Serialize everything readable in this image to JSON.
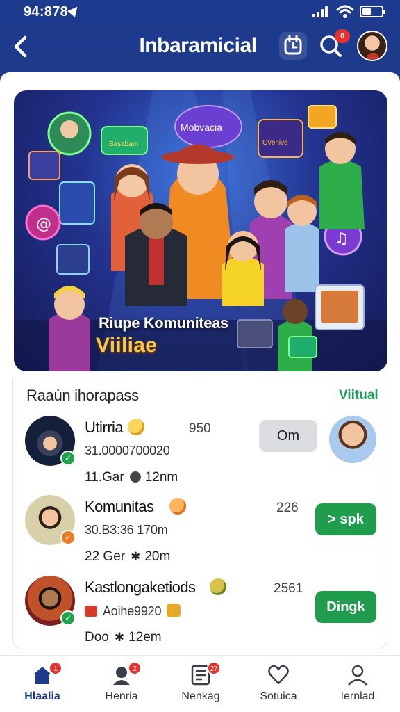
{
  "status": {
    "time": "94:878"
  },
  "header": {
    "title": "Inbaramicial",
    "notification_badge": "8"
  },
  "hero": {
    "title": "Riupe Komuniteas",
    "subtitle": "Viiliae",
    "bubble_text": "Mobvacia",
    "sign_left": "Basabam",
    "sign_right": "Ovenive"
  },
  "section": {
    "title": "Raaùn ihorapass",
    "link": "Viitual"
  },
  "rows": [
    {
      "name": "Utirria",
      "count": "950",
      "sub": "31.0000700020",
      "meta_left": "11.Gar",
      "meta_right": "12nm",
      "action": "Om"
    },
    {
      "name": "Komunitas",
      "count": "226",
      "sub": "30.B3:36 170m",
      "meta_left": "22 Ger",
      "meta_right": "20m",
      "action": "> spk"
    },
    {
      "name": "Kastlongaketiods",
      "count": "2561",
      "sub": "Aoihe9920",
      "meta_left": "Doo",
      "meta_right": "12em",
      "action": "Dingk"
    }
  ],
  "nav": [
    {
      "label": "Hlaalia",
      "badge": "1",
      "icon": "home-icon"
    },
    {
      "label": "Henria",
      "badge": "2",
      "icon": "users-icon"
    },
    {
      "label": "Nenkag",
      "badge": "27",
      "icon": "news-icon"
    },
    {
      "label": "Sotuica",
      "badge": "",
      "icon": "heart-icon"
    },
    {
      "label": "Iernlad",
      "badge": "",
      "icon": "profile-icon"
    }
  ],
  "colors": {
    "header": "#1e3a8a",
    "accent_green": "#1f9d4d",
    "badge_red": "#e5322d"
  }
}
